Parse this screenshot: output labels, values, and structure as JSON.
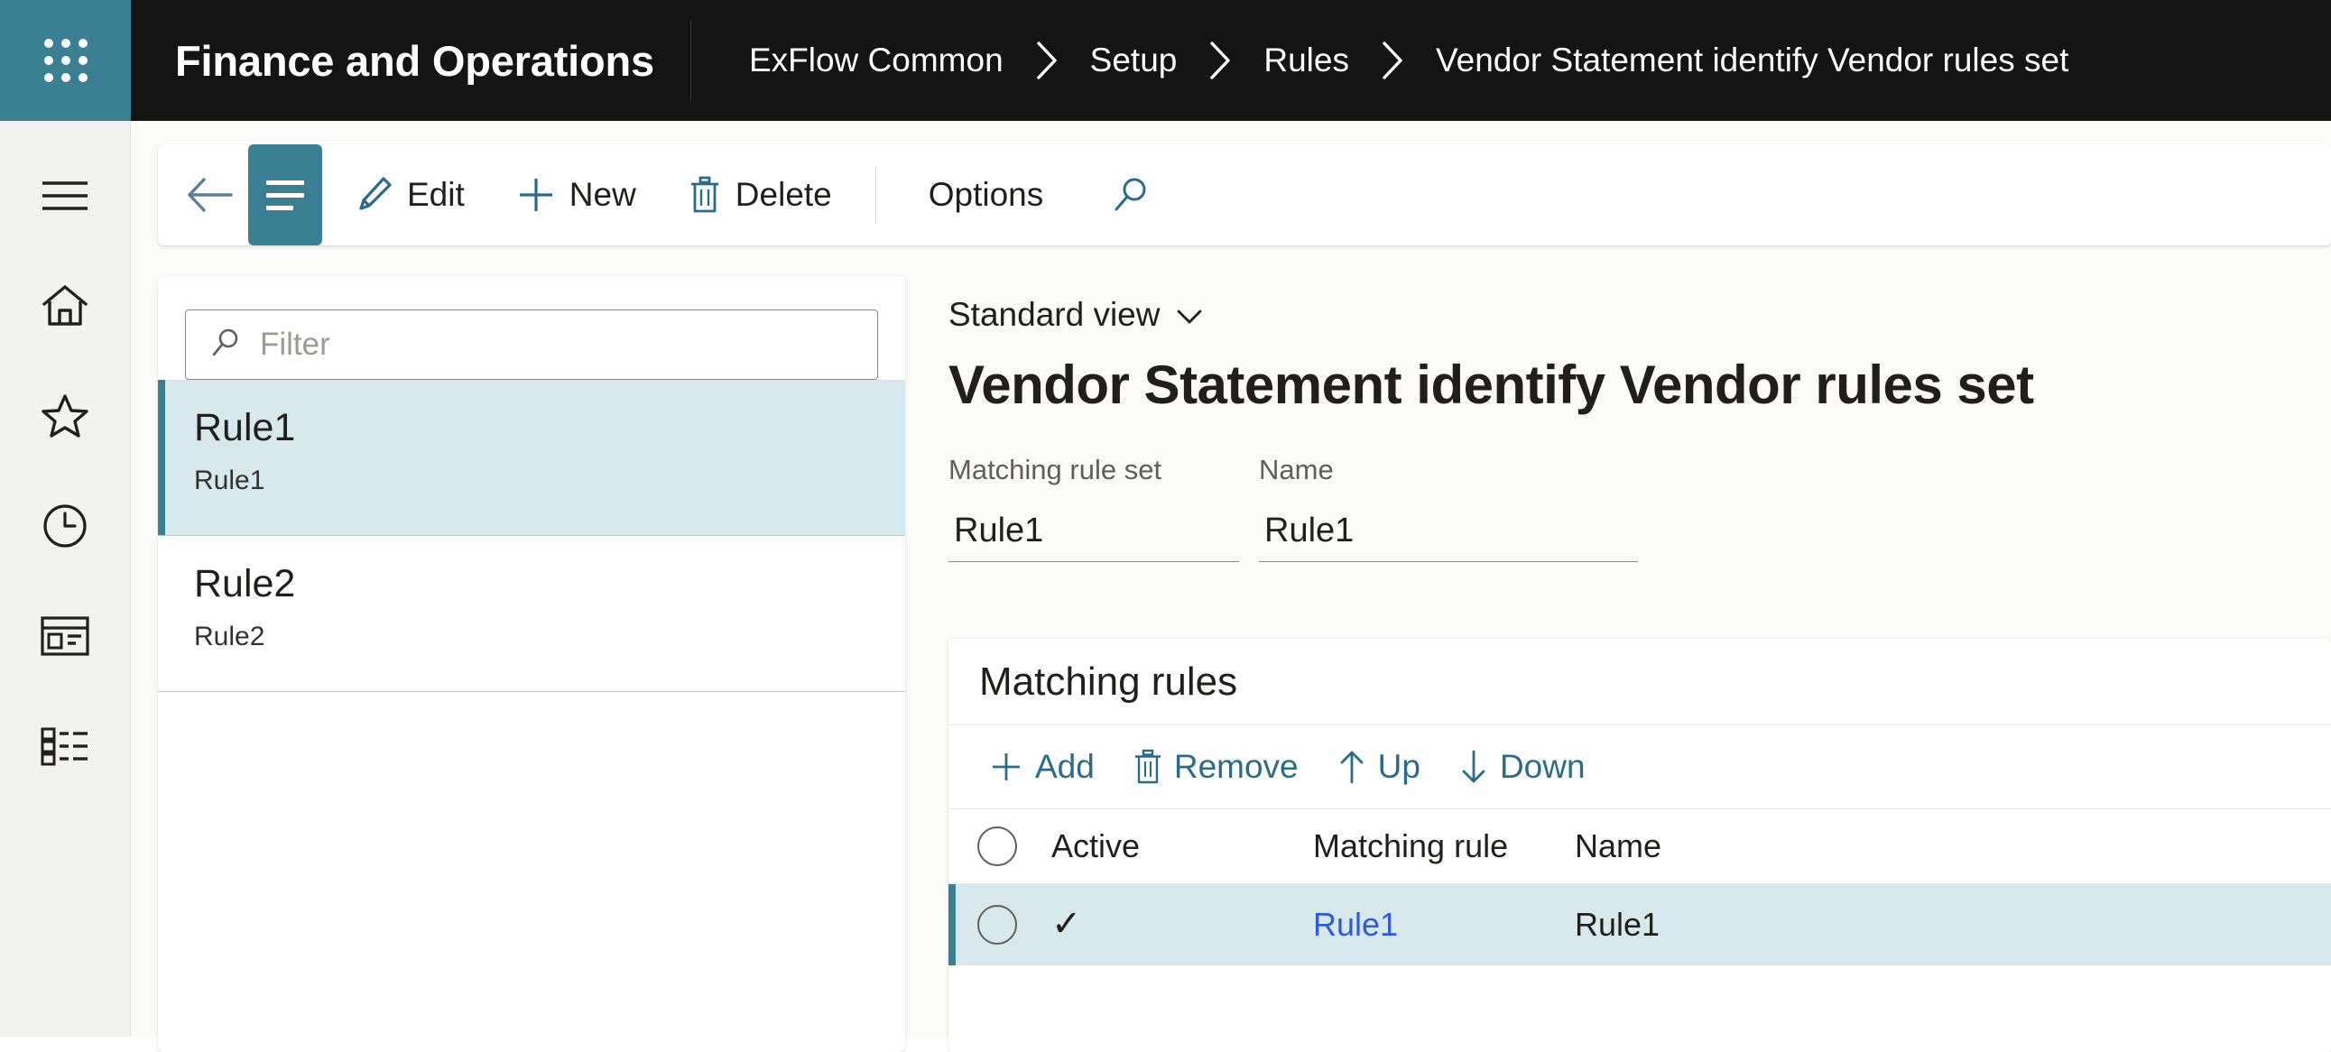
{
  "topbar": {
    "waffle_icon": "waffle-grid-icon",
    "app_title": "Finance and Operations",
    "breadcrumb": [
      {
        "label": "ExFlow Common"
      },
      {
        "label": "Setup"
      },
      {
        "label": "Rules"
      },
      {
        "label": "Vendor Statement identify Vendor rules set"
      }
    ]
  },
  "rail": {
    "items": [
      {
        "name": "hamburger-menu-icon",
        "icon": "hamburger"
      },
      {
        "name": "home-icon",
        "icon": "home"
      },
      {
        "name": "favorites-star-icon",
        "icon": "star"
      },
      {
        "name": "recent-clock-icon",
        "icon": "clock"
      },
      {
        "name": "workspaces-icon",
        "icon": "workspace"
      },
      {
        "name": "modules-list-icon",
        "icon": "modules"
      }
    ]
  },
  "commandbar": {
    "back_icon": "back-arrow-icon",
    "hamburger_icon": "list-menu-icon",
    "buttons": [
      {
        "label": "Edit",
        "icon": "pencil-icon"
      },
      {
        "label": "New",
        "icon": "plus-icon"
      },
      {
        "label": "Delete",
        "icon": "trash-icon"
      },
      {
        "label": "Options",
        "icon": ""
      }
    ],
    "search_icon": "search-icon"
  },
  "listpane": {
    "filter_placeholder": "Filter",
    "filter_value": "",
    "filter_icon": "search-icon",
    "items": [
      {
        "title": "Rule1",
        "subtitle": "Rule1",
        "selected": true
      },
      {
        "title": "Rule2",
        "subtitle": "Rule2",
        "selected": false
      }
    ]
  },
  "detail": {
    "view_selector": "Standard view",
    "view_chevron": "chevron-down-icon",
    "page_title": "Vendor Statement identify Vendor rules set",
    "fields": [
      {
        "label": "Matching rule set",
        "value": "Rule1"
      },
      {
        "label": "Name",
        "value": "Rule1"
      }
    ],
    "rules_section": {
      "heading": "Matching rules",
      "toolbar": [
        {
          "label": "Add",
          "icon": "plus-icon"
        },
        {
          "label": "Remove",
          "icon": "trash-icon"
        },
        {
          "label": "Up",
          "icon": "arrow-up-icon"
        },
        {
          "label": "Down",
          "icon": "arrow-down-icon"
        }
      ],
      "columns": [
        "Active",
        "Matching rule",
        "Name"
      ],
      "rows": [
        {
          "active": "✓",
          "matching_rule": "Rule1",
          "name": "Rule1",
          "selected": true
        }
      ]
    }
  },
  "colors": {
    "accent_teal": "#3b7f92",
    "topbar_black": "#141414",
    "selection_blue": "#d7e8ec",
    "link_blue": "#2b5bd7",
    "command_link": "#2b6b8a"
  }
}
